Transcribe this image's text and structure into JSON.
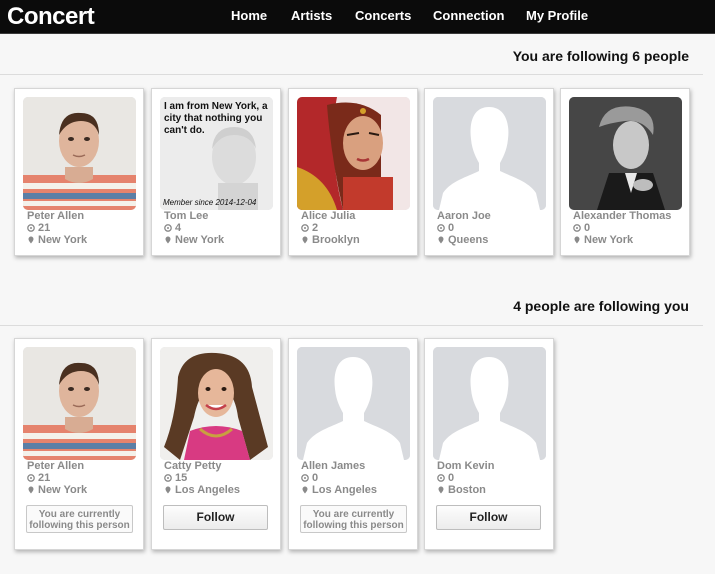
{
  "app": {
    "brand": "Concert"
  },
  "nav": [
    "Home",
    "Artists",
    "Concerts",
    "Connection",
    "My Profile"
  ],
  "following": {
    "title": "You are following 6 people",
    "people": [
      {
        "name": "Peter Allen",
        "count": "21",
        "location": "New York",
        "photo": "man-striped-shirt"
      },
      {
        "name": "Tom Lee",
        "count": "4",
        "location": "New York",
        "photo": "faded-portrait",
        "quote": "I am from New York, a city that nothing you can't do.",
        "member_since": "Member since 2014-12-04"
      },
      {
        "name": "Alice Julia",
        "count": "2",
        "location": "Brooklyn",
        "photo": "woman-red-veil"
      },
      {
        "name": "Aaron Joe",
        "count": "0",
        "location": "Queens",
        "photo": "default-avatar"
      },
      {
        "name": "Alexander Thomas",
        "count": "0",
        "location": "New York",
        "photo": "man-bw-portrait"
      }
    ]
  },
  "followers": {
    "title": "4 people are following you",
    "people": [
      {
        "name": "Peter Allen",
        "count": "21",
        "location": "New York",
        "photo": "man-striped-shirt",
        "status": "You are currently following this person"
      },
      {
        "name": "Catty Petty",
        "count": "15",
        "location": "Los Angeles",
        "photo": "woman-pink-top",
        "action": "Follow"
      },
      {
        "name": "Allen James",
        "count": "0",
        "location": "Los Angeles",
        "photo": "default-avatar",
        "status": "You are currently following this person"
      },
      {
        "name": "Dom Kevin",
        "count": "0",
        "location": "Boston",
        "photo": "default-avatar",
        "action": "Follow"
      }
    ]
  }
}
